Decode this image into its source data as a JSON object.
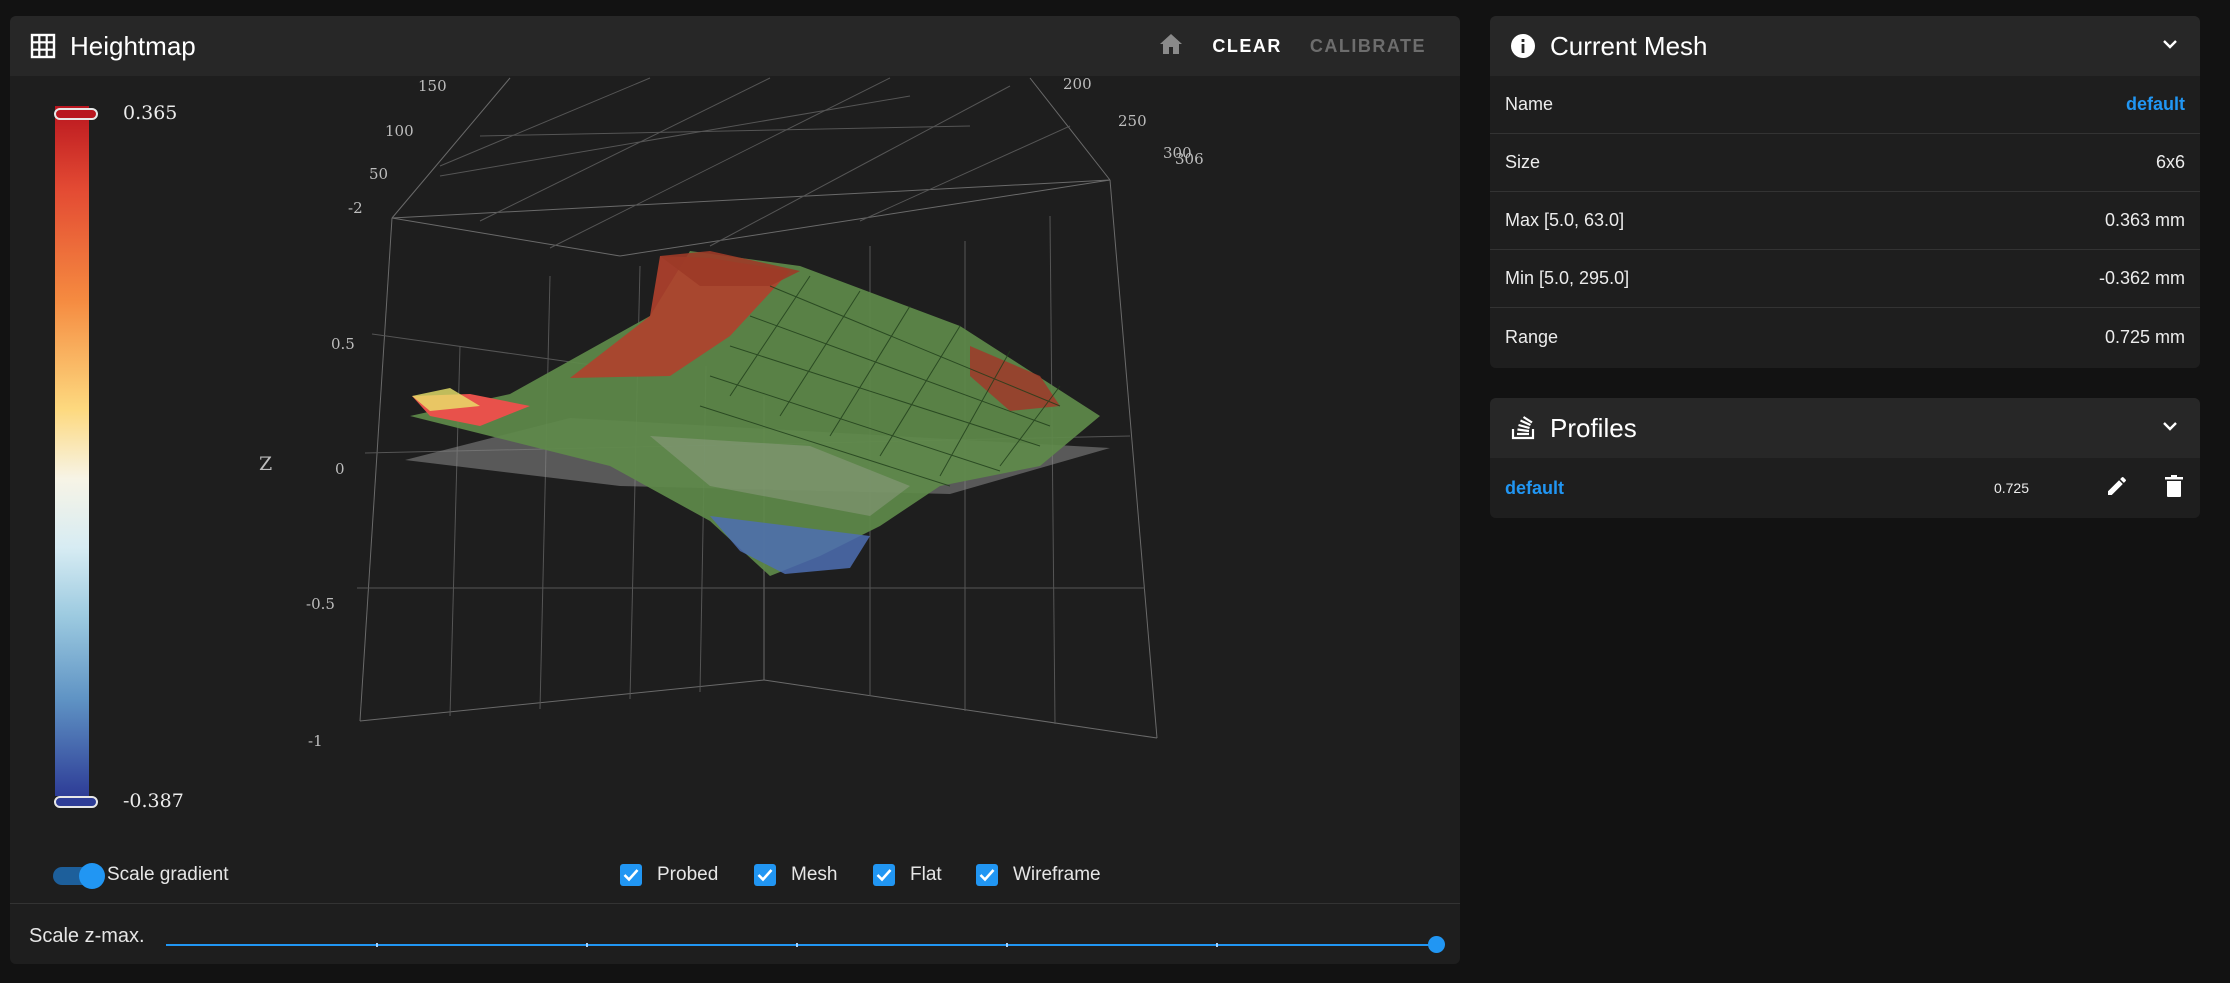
{
  "heightmap": {
    "title": "Heightmap",
    "icon": "grid-icon",
    "clear_label": "CLEAR",
    "calibrate_label": "CALIBRATE",
    "legend": {
      "max": "0.365",
      "min": "-0.387"
    },
    "axis": {
      "z_label": "Z",
      "z_ticks": [
        "0.5",
        "0",
        "-0.5",
        "-1"
      ],
      "left_ticks": [
        "150",
        "100",
        "50",
        "-2"
      ],
      "right_ticks": [
        "200",
        "250",
        "300",
        "306"
      ]
    },
    "scale_gradient_label": "Scale gradient",
    "scale_gradient_on": true,
    "checkboxes": [
      {
        "label": "Probed",
        "checked": true
      },
      {
        "label": "Mesh",
        "checked": true
      },
      {
        "label": "Flat",
        "checked": true
      },
      {
        "label": "Wireframe",
        "checked": true
      }
    ],
    "scale_zmax_label": "Scale z-max.",
    "scale_zmax_value": 1.0
  },
  "current_mesh": {
    "title": "Current Mesh",
    "rows": [
      {
        "key": "Name",
        "value": "default"
      },
      {
        "key": "Size",
        "value": "6x6"
      },
      {
        "key": "Max [5.0, 63.0]",
        "value": "0.363 mm"
      },
      {
        "key": "Min [5.0, 295.0]",
        "value": "-0.362 mm"
      },
      {
        "key": "Range",
        "value": "0.725 mm"
      }
    ]
  },
  "profiles": {
    "title": "Profiles",
    "items": [
      {
        "name": "default",
        "range": "0.725"
      }
    ]
  },
  "colors": {
    "accent": "#2196f3",
    "background": "#121212",
    "card": "#1e1e1e",
    "card_header": "#272727"
  }
}
